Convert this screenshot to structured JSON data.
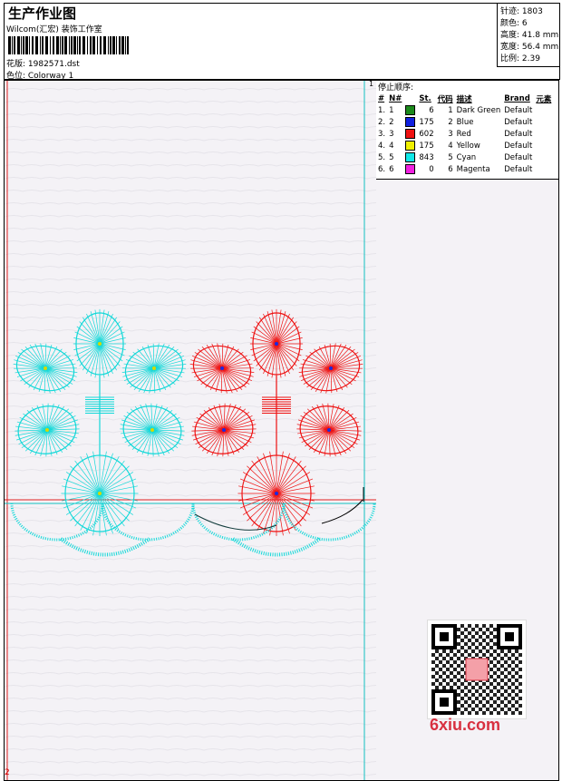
{
  "header": {
    "title": "生产作业图",
    "subtitle": "Wilcom(汇宏) 装饰工作室",
    "design_label": "花版:  1982571.dst",
    "colorway_label": "色位:  Colorway 1"
  },
  "stats": {
    "stitches": "针迹: 1803",
    "colors": "颜色: 6",
    "height": "高度: 41.8 mm",
    "width": "宽度: 56.4 mm",
    "scale": "比例: 2.39"
  },
  "sequence": {
    "label": "停止顺序:",
    "headers": {
      "idx": "#",
      "no": "N#",
      "st": "St.",
      "code": "代码",
      "desc": "描述",
      "brand": "Brand",
      "elem": "元素"
    },
    "rows": [
      {
        "idx": "1.",
        "no": "1",
        "color": "#1c8a1c",
        "st": "6",
        "code": "1",
        "desc": "Dark Green",
        "brand": "Default"
      },
      {
        "idx": "2.",
        "no": "2",
        "color": "#1020e0",
        "st": "175",
        "code": "2",
        "desc": "Blue",
        "brand": "Default"
      },
      {
        "idx": "3.",
        "no": "3",
        "color": "#ee1111",
        "st": "602",
        "code": "3",
        "desc": "Red",
        "brand": "Default"
      },
      {
        "idx": "4.",
        "no": "4",
        "color": "#f0f000",
        "st": "175",
        "code": "4",
        "desc": "Yellow",
        "brand": "Default"
      },
      {
        "idx": "5.",
        "no": "5",
        "color": "#10e8e8",
        "st": "843",
        "code": "5",
        "desc": "Cyan",
        "brand": "Default"
      },
      {
        "idx": "6.",
        "no": "6",
        "color": "#f020e0",
        "st": "0",
        "code": "6",
        "desc": "Magenta",
        "brand": "Default"
      }
    ]
  },
  "design": {
    "corner_bottom": "2",
    "corner_top": "1",
    "thread_colors": {
      "cyan": "#12d8d8",
      "red": "#ee1111",
      "blue": "#1a2be0",
      "green": "#1c8a1c",
      "yellow": "#d8d800"
    }
  },
  "watermark": {
    "text": "6xiu.com"
  }
}
